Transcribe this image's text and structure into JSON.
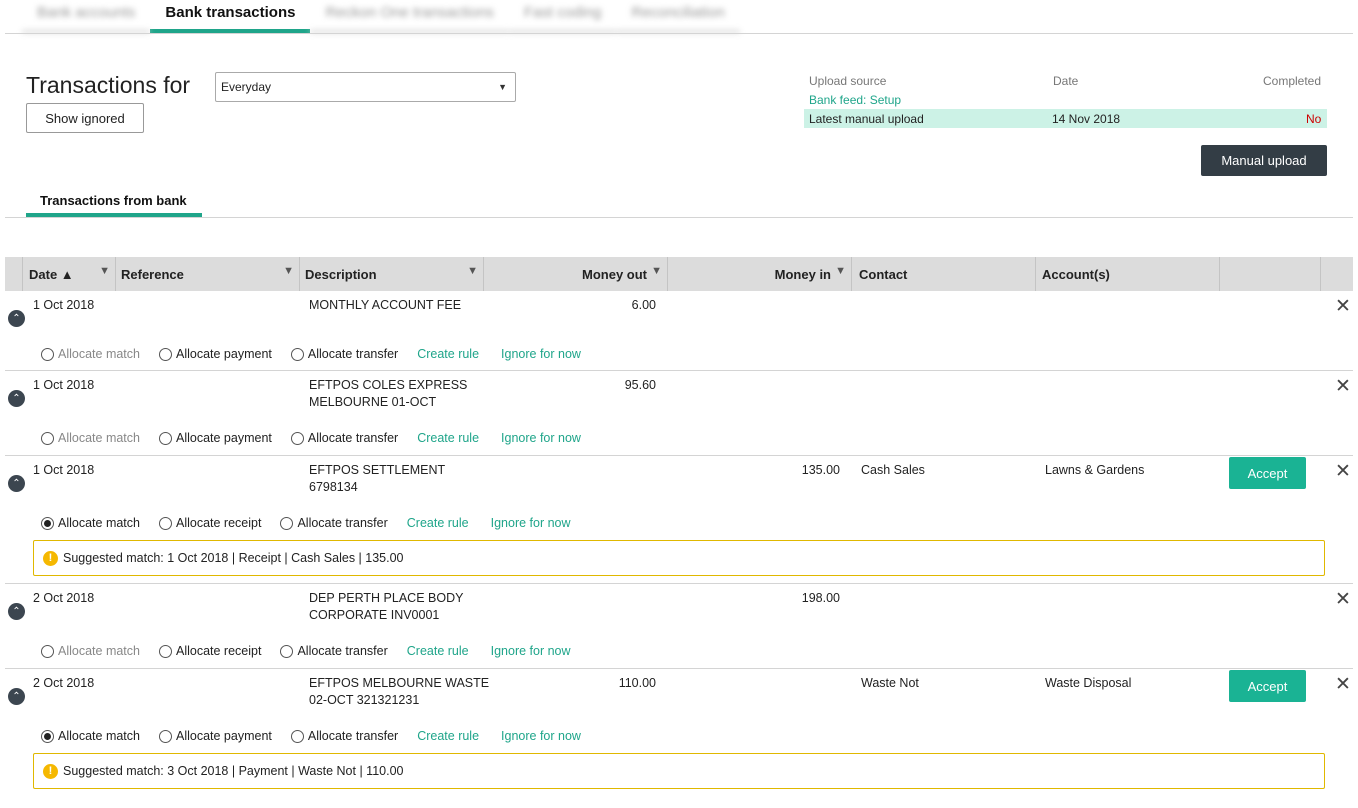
{
  "top_tabs": [
    "Bank accounts",
    "Bank transactions",
    "Reckon One transactions",
    "Fast coding",
    "Reconciliation"
  ],
  "page": {
    "title": "Transactions for",
    "show_ignored": "Show ignored",
    "account_select": "Everyday"
  },
  "upload": {
    "headers": {
      "source": "Upload source",
      "date": "Date",
      "completed": "Completed"
    },
    "bank_feed_link": "Bank feed: Setup",
    "latest": {
      "label": "Latest manual upload",
      "date": "14 Nov 2018",
      "completed": "No"
    },
    "manual_upload_button": "Manual upload",
    "colors": {
      "highlight": "#ccf2e6",
      "no": "#cc0000"
    }
  },
  "subtab": "Transactions from bank",
  "table": {
    "headers": {
      "date": "Date ▲",
      "reference": "Reference",
      "description": "Description",
      "money_out": "Money out",
      "money_in": "Money in",
      "contact": "Contact",
      "accounts": "Account(s)"
    },
    "common": {
      "allocate_match": "Allocate match",
      "allocate_payment": "Allocate payment",
      "allocate_receipt": "Allocate receipt",
      "allocate_transfer": "Allocate transfer",
      "create_rule": "Create rule",
      "ignore_for_now": "Ignore for now",
      "accept": "Accept"
    },
    "rows": [
      {
        "date": "1 Oct 2018",
        "desc1": "MONTHLY ACCOUNT FEE",
        "desc2": "",
        "money_out": "6.00",
        "money_in": "",
        "contact": "",
        "account": ""
      },
      {
        "date": "1 Oct 2018",
        "desc1": "EFTPOS COLES EXPRESS",
        "desc2": "MELBOURNE 01-OCT",
        "money_out": "95.60",
        "money_in": "",
        "contact": "",
        "account": ""
      },
      {
        "date": "1 Oct 2018",
        "desc1": "EFTPOS SETTLEMENT",
        "desc2": "6798134",
        "money_out": "",
        "money_in": "135.00",
        "contact": "Cash Sales",
        "account": "Lawns & Gardens",
        "suggestion": "Suggested match: 1 Oct 2018 | Receipt | Cash Sales | 135.00"
      },
      {
        "date": "2 Oct 2018",
        "desc1": "DEP PERTH PLACE BODY",
        "desc2": "CORPORATE INV0001",
        "money_out": "",
        "money_in": "198.00",
        "contact": "",
        "account": ""
      },
      {
        "date": "2 Oct 2018",
        "desc1": "EFTPOS MELBOURNE WASTE",
        "desc2": "02-OCT 321321231",
        "money_out": "110.00",
        "money_in": "",
        "contact": "Waste Not",
        "account": "Waste Disposal",
        "suggestion": "Suggested match: 3 Oct 2018 | Payment | Waste Not | 110.00"
      }
    ]
  },
  "icons": {
    "filter": "filter-icon",
    "collapse": "chevron-up-icon",
    "close": "close-icon",
    "warning": "warning-icon"
  }
}
